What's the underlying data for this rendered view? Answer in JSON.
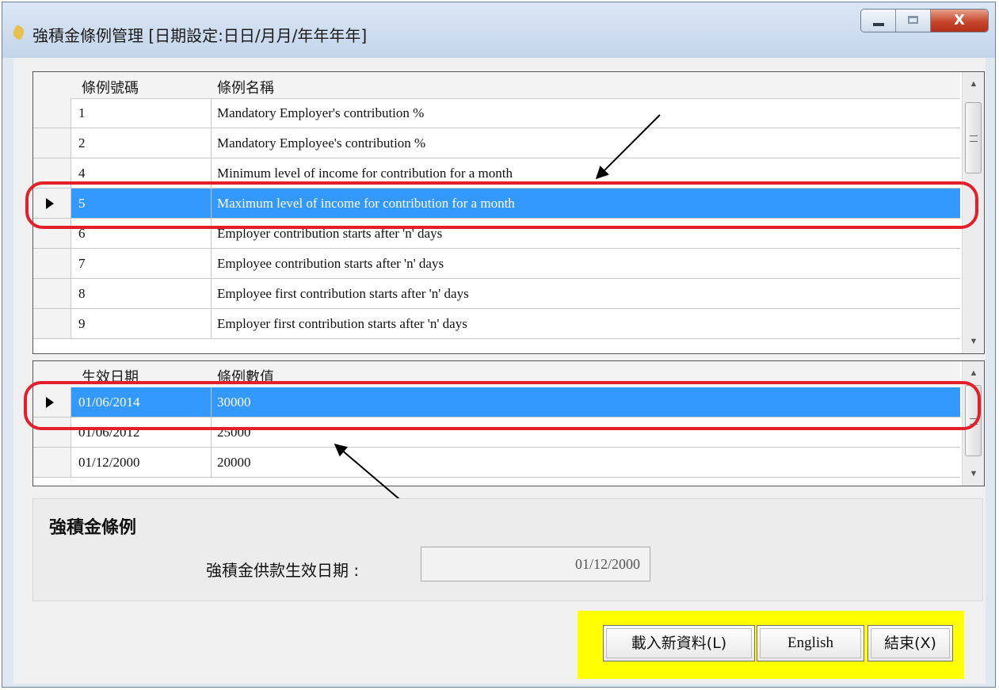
{
  "window": {
    "title": "強積金條例管理 [日期設定:日日/月月/年年年年]",
    "close_glyph": "X"
  },
  "rules_grid": {
    "headers": [
      "條例號碼",
      "條例名稱"
    ],
    "rows": [
      {
        "code": "1",
        "name": "Mandatory Employer's contribution %"
      },
      {
        "code": "2",
        "name": "Mandatory Employee's contribution %"
      },
      {
        "code": "4",
        "name": "Minimum level of income for contribution for a month"
      },
      {
        "code": "5",
        "name": "Maximum level of income for contribution for a month"
      },
      {
        "code": "6",
        "name": "Employer contribution starts after 'n' days"
      },
      {
        "code": "7",
        "name": "Employee contribution starts after 'n' days"
      },
      {
        "code": "8",
        "name": "Employee first contribution starts after 'n' days"
      },
      {
        "code": "9",
        "name": "Employer first contribution starts after 'n' days"
      }
    ],
    "selected_index": 3
  },
  "values_grid": {
    "headers": [
      "生效日期",
      "條例數值"
    ],
    "rows": [
      {
        "date": "01/06/2014",
        "value": "30000"
      },
      {
        "date": "01/06/2012",
        "value": "25000"
      },
      {
        "date": "01/12/2000",
        "value": "20000"
      }
    ],
    "selected_index": 0
  },
  "panel": {
    "title": "強積金條例",
    "date_label": "強積金供款生效日期 :",
    "date_value": "01/12/2000"
  },
  "buttons": {
    "load": "載入新資料(L)",
    "english": "English",
    "exit": "結束(X)"
  },
  "icons": [
    "app-icon",
    "minimize-icon",
    "maximize-icon",
    "close-icon",
    "row-pointer-icon",
    "scroll-up-icon",
    "scroll-down-icon"
  ],
  "colors": {
    "selection": "#3399ff",
    "annotation": "#e21f2a",
    "button_bar": "#ffff00"
  }
}
